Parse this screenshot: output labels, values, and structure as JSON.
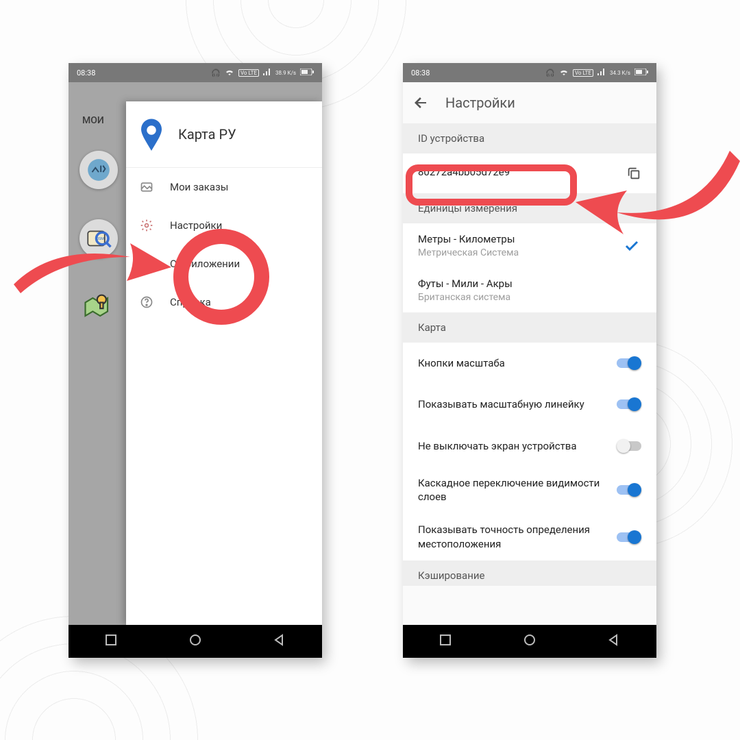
{
  "status": {
    "time": "08:38",
    "volte": "Vo LTE",
    "rate_left": "38.9 K/s",
    "rate_right": "34.3 K/s",
    "battery": "60"
  },
  "left": {
    "tab_peek": "МОИ",
    "app_title": "Карта РУ",
    "menu": [
      {
        "icon": "map",
        "label": "Мои заказы"
      },
      {
        "icon": "gear",
        "label": "Настройки"
      },
      {
        "icon": "info",
        "label": "О приложении"
      },
      {
        "icon": "help",
        "label": "Справка"
      }
    ]
  },
  "right": {
    "title": "Настройки",
    "sec_id": "ID устройства",
    "device_id": "80272a4bb05d72e9",
    "sec_units": "Единицы измерения",
    "unit_metric_t": "Метры - Километры",
    "unit_metric_s": "Метрическая Система",
    "unit_imp_t": "Футы - Мили - Акры",
    "unit_imp_s": "Британская система",
    "sec_map": "Карта",
    "sw1": "Кнопки масштаба",
    "sw2": "Показывать масштабную линейку",
    "sw3": "Не выключать экран устройства",
    "sw4": "Каскадное переключение видимости слоев",
    "sw5": "Показывать точность определения местоположения",
    "sec_cache": "Кэширование"
  },
  "switches": {
    "sw1": true,
    "sw2": true,
    "sw3": false,
    "sw4": true,
    "sw5": true
  }
}
